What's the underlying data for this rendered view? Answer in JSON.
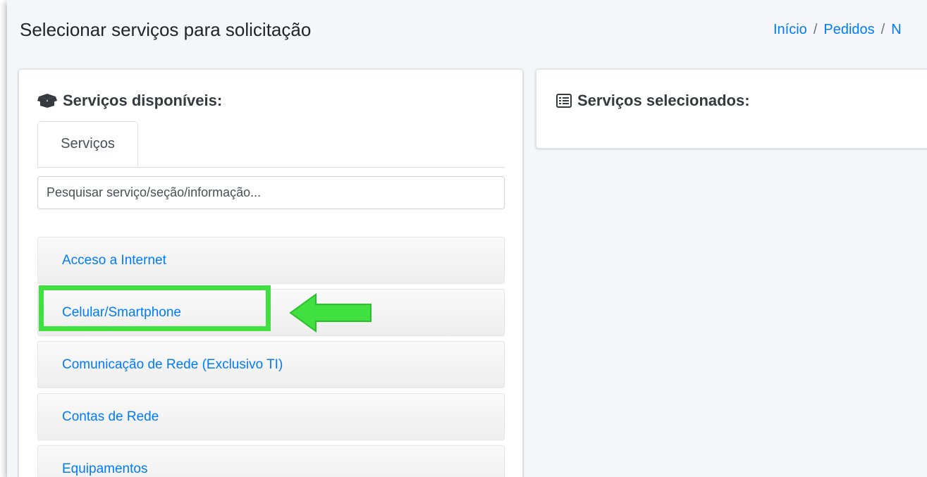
{
  "page": {
    "title": "Selecionar serviços para solicitação",
    "breadcrumb": [
      "Início",
      "Pedidos",
      "N"
    ]
  },
  "available": {
    "title": "Serviços disponíveis:",
    "icon": "box-open-icon",
    "tabs": [
      "Serviços"
    ],
    "search_placeholder": "Pesquisar serviço/seção/informação...",
    "services": [
      "Acceso a Internet",
      "Celular/Smartphone",
      "Comunicação de Rede (Exclusivo TI)",
      "Contas de Rede",
      "Equipamentos"
    ]
  },
  "selected": {
    "title": "Serviços selecionados:",
    "icon": "list-alt-icon"
  },
  "annotation": {
    "highlight_color": "#3fe03f",
    "highlighted_service": "Celular/Smartphone"
  }
}
